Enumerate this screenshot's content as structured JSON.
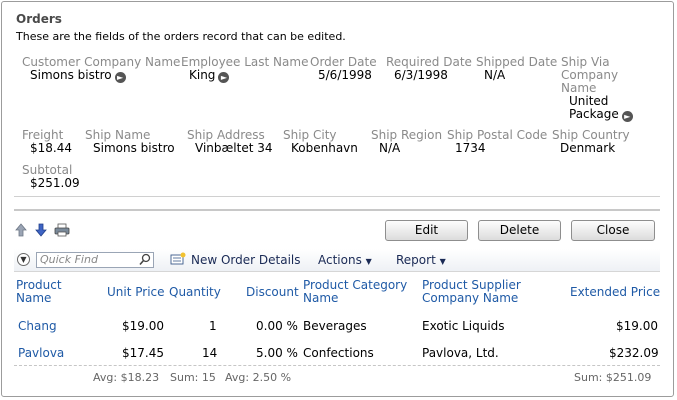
{
  "form": {
    "title": "Orders",
    "description": "These are the fields of the orders record that can be edited.",
    "fields": {
      "customer_company_name": {
        "label": "Customer Company Name",
        "value": "Simons bistro"
      },
      "employee_last_name": {
        "label": "Employee Last Name",
        "value": "King"
      },
      "order_date": {
        "label": "Order Date",
        "value": "5/6/1998"
      },
      "required_date": {
        "label": "Required Date",
        "value": "6/3/1998"
      },
      "shipped_date": {
        "label": "Shipped Date",
        "value": "N/A"
      },
      "ship_via_label_1": "Ship Via",
      "ship_via_label_2": "Company",
      "ship_via_label_3": "Name",
      "ship_via_value_1": "United",
      "ship_via_value_2": "Package",
      "freight": {
        "label": "Freight",
        "value": "$18.44"
      },
      "ship_name": {
        "label": "Ship Name",
        "value": "Simons bistro"
      },
      "ship_address": {
        "label": "Ship Address",
        "value": "Vinbæltet 34"
      },
      "ship_city": {
        "label": "Ship City",
        "value": "Kobenhavn"
      },
      "ship_region": {
        "label": "Ship Region",
        "value": "N/A"
      },
      "ship_postal_code": {
        "label": "Ship Postal Code",
        "value": "1734"
      },
      "ship_country": {
        "label": "Ship Country",
        "value": "Denmark"
      },
      "subtotal": {
        "label": "Subtotal",
        "value": "$251.09"
      }
    }
  },
  "buttons": {
    "edit": "Edit",
    "delete": "Delete",
    "close": "Close"
  },
  "icons": {
    "up": "arrow-up-icon",
    "down": "arrow-down-icon",
    "print": "printer-icon",
    "lookup": "circle-arrow-right-icon",
    "search": "search-icon",
    "new": "new-record-icon",
    "collapse": "collapse-chevron-icon"
  },
  "toolbar": {
    "quick_find_placeholder": "Quick Find",
    "new_order_details": "New Order Details",
    "actions": "Actions",
    "report": "Report"
  },
  "grid": {
    "headers": {
      "product_name_1": "Product",
      "product_name_2": "Name",
      "unit_price": "Unit Price",
      "quantity": "Quantity",
      "discount": "Discount",
      "category_1": "Product Category",
      "category_2": "Name",
      "supplier_1": "Product Supplier",
      "supplier_2": "Company Name",
      "extended_price": "Extended Price"
    },
    "rows": [
      {
        "product": "Chang",
        "unit_price": "$19.00",
        "quantity": "1",
        "discount": "0.00 %",
        "category": "Beverages",
        "supplier": "Exotic Liquids",
        "extended": "$19.00"
      },
      {
        "product": "Pavlova",
        "unit_price": "$17.45",
        "quantity": "14",
        "discount": "5.00 %",
        "category": "Confections",
        "supplier": "Pavlova, Ltd.",
        "extended": "$232.09"
      }
    ],
    "footer": {
      "avg_price": "Avg: $18.23",
      "sum_qty": "Sum: 15",
      "avg_discount": "Avg: 2.50 %",
      "sum_extended": "Sum: $251.09"
    }
  },
  "colors": {
    "link": "#1f5aa6",
    "label": "#8a8a8a",
    "border": "#9c9c9c"
  }
}
